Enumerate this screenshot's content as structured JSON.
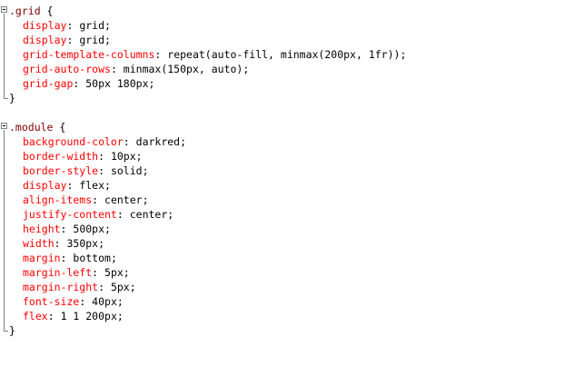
{
  "editor": {
    "blocks": [
      {
        "selector": ".grid",
        "open": " {",
        "declarations": [
          {
            "property": "display",
            "value": " grid;"
          },
          {
            "property": "display",
            "value": " grid;"
          },
          {
            "property": "grid-template-columns",
            "value": " repeat(auto-fill, minmax(200px, 1fr));"
          },
          {
            "property": "grid-auto-rows",
            "value": " minmax(150px, auto);"
          },
          {
            "property": "grid-gap",
            "value": " 50px 180px;"
          }
        ],
        "close": "}"
      },
      {
        "selector": ".module",
        "open": " {",
        "declarations": [
          {
            "property": "background-color",
            "value": " darkred;"
          },
          {
            "property": "border-width",
            "value": " 10px;"
          },
          {
            "property": "border-style",
            "value": " solid;"
          },
          {
            "property": "display",
            "value": " flex;"
          },
          {
            "property": "align-items",
            "value": " center;"
          },
          {
            "property": "justify-content",
            "value": " center;"
          },
          {
            "property": "height",
            "value": " 500px;"
          },
          {
            "property": "width",
            "value": " 350px;"
          },
          {
            "property": "margin",
            "value": " bottom;"
          },
          {
            "property": "margin-left",
            "value": " 5px;"
          },
          {
            "property": "margin-right",
            "value": " 5px;"
          },
          {
            "property": "font-size",
            "value": " 40px;"
          },
          {
            "property": "flex",
            "value": " 1 1 200px;"
          }
        ],
        "close": "}"
      }
    ],
    "separator": ":"
  },
  "colors": {
    "selector": "#800000",
    "property": "#ff0000",
    "value": "#000000",
    "background": "#ffffff"
  }
}
